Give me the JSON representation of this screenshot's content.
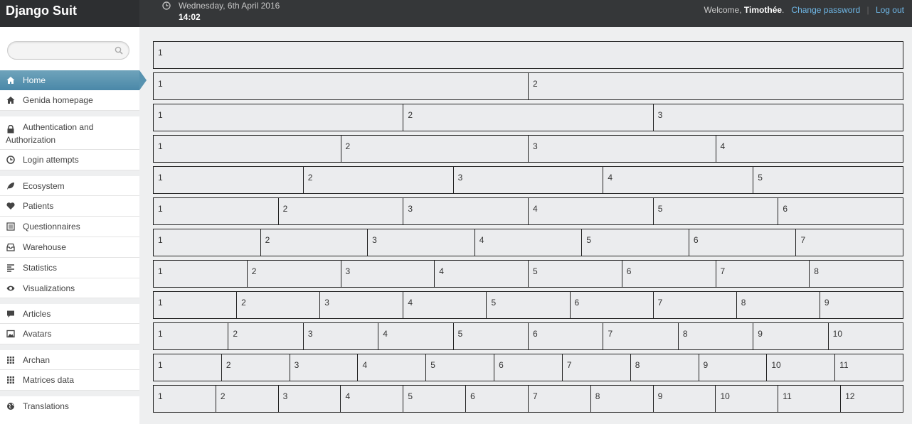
{
  "header": {
    "brand": "Django Suit",
    "date": "Wednesday, 6th April 2016",
    "time": "14:02",
    "welcome": "Welcome,",
    "user": "Timothée",
    "user_suffix": ".",
    "change_password": "Change password",
    "separator": "|",
    "logout": "Log out"
  },
  "sidebar": {
    "search": {
      "placeholder": "",
      "value": ""
    },
    "items": [
      {
        "label": "Home",
        "icon": "home-icon",
        "active": true
      },
      {
        "label": "Genida homepage",
        "icon": "home-icon"
      },
      {
        "label": "Authentication and Authorization",
        "icon": "lock-icon"
      },
      {
        "label": "Login attempts",
        "icon": "clock-icon"
      },
      {
        "label": "Ecosystem",
        "icon": "leaf-icon"
      },
      {
        "label": "Patients",
        "icon": "heart-icon"
      },
      {
        "label": "Questionnaires",
        "icon": "list-icon"
      },
      {
        "label": "Warehouse",
        "icon": "inbox-icon"
      },
      {
        "label": "Statistics",
        "icon": "align-left-icon"
      },
      {
        "label": "Visualizations",
        "icon": "eye-icon"
      },
      {
        "label": "Articles",
        "icon": "comment-icon"
      },
      {
        "label": "Avatars",
        "icon": "picture-icon"
      },
      {
        "label": "Archan",
        "icon": "grid-icon"
      },
      {
        "label": "Matrices data",
        "icon": "grid-icon"
      },
      {
        "label": "Translations",
        "icon": "globe-icon"
      }
    ]
  },
  "main": {
    "rows": [
      [
        "1"
      ],
      [
        "1",
        "2"
      ],
      [
        "1",
        "2",
        "3"
      ],
      [
        "1",
        "2",
        "3",
        "4"
      ],
      [
        "1",
        "2",
        "3",
        "4",
        "5"
      ],
      [
        "1",
        "2",
        "3",
        "4",
        "5",
        "6"
      ],
      [
        "1",
        "2",
        "3",
        "4",
        "5",
        "6",
        "7"
      ],
      [
        "1",
        "2",
        "3",
        "4",
        "5",
        "6",
        "7",
        "8"
      ],
      [
        "1",
        "2",
        "3",
        "4",
        "5",
        "6",
        "7",
        "8",
        "9"
      ],
      [
        "1",
        "2",
        "3",
        "4",
        "5",
        "6",
        "7",
        "8",
        "9",
        "10"
      ],
      [
        "1",
        "2",
        "3",
        "4",
        "5",
        "6",
        "7",
        "8",
        "9",
        "10",
        "11"
      ],
      [
        "1",
        "2",
        "3",
        "4",
        "5",
        "6",
        "7",
        "8",
        "9",
        "10",
        "11",
        "12"
      ]
    ]
  },
  "colors": {
    "header_bg": "#353739",
    "active_nav": "#5893b0",
    "link": "#6fb7e6",
    "page_bg": "#eeeff0"
  }
}
